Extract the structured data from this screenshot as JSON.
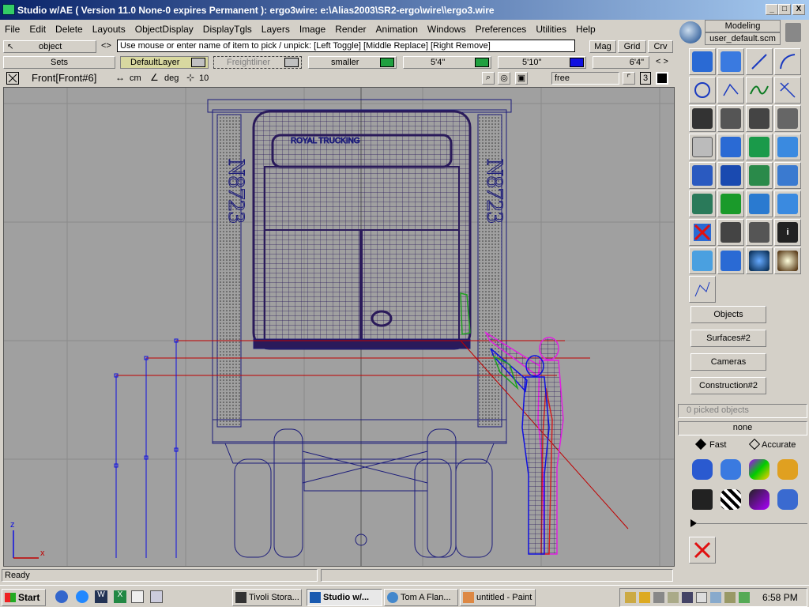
{
  "window": {
    "title": "Studio w/AE ( Version 11.0 None-0 expires Permanent ): ergo3wire: e:\\Alias2003\\SR2-ergo\\wire\\\\ergo3.wire",
    "min_label": "_",
    "max_label": "□",
    "close_label": "X"
  },
  "menu": [
    "File",
    "Edit",
    "Delete",
    "Layouts",
    "ObjectDisplay",
    "DisplayTgls",
    "Layers",
    "Image",
    "Render",
    "Animation",
    "Windows",
    "Preferences",
    "Utilities",
    "Help"
  ],
  "pick": {
    "mode": "object",
    "arrows": "<>",
    "prompt": "Use mouse or enter name of item to pick / unpick: [Left Toggle] [Middle Replace] [Right Remove]",
    "mag": "Mag",
    "grid": "Grid",
    "crv": "Crv"
  },
  "sets": {
    "sets_label": "Sets",
    "default_layer": "DefaultLayer",
    "freightliner": "Freightliner",
    "smaller": "smaller",
    "h1": "5'4\"",
    "h2": "5'10\"",
    "h3": "6'4\"",
    "nav": "< >"
  },
  "view": {
    "name": "Front[Front#6]",
    "units_len": "cm",
    "units_ang": "deg",
    "grid_num": "10",
    "mode": "free",
    "num": "3",
    "axis_z": "z",
    "axis_x": "x"
  },
  "status": {
    "text": "Ready"
  },
  "right": {
    "modeling": "Modeling",
    "shelf": "user_default.scm",
    "tabs": [
      "Objects",
      "Surfaces#2",
      "Cameras",
      "Construction#2"
    ],
    "picked": "0 picked objects",
    "none": "none",
    "fast": "Fast",
    "accurate": "Accurate"
  },
  "taskbar": {
    "start": "Start",
    "tasks": [
      "Tivoli Stora...",
      "Studio w/...",
      "Tom A Flan...",
      "untitled - Paint"
    ],
    "clock": "6:58 PM"
  },
  "colors": {
    "wire": "#1c1c7a",
    "figure_blue": "#1010e0",
    "figure_magenta": "#e020e0",
    "figure_red": "#d02020",
    "construction_red": "#c00000",
    "green": "#20a020"
  }
}
